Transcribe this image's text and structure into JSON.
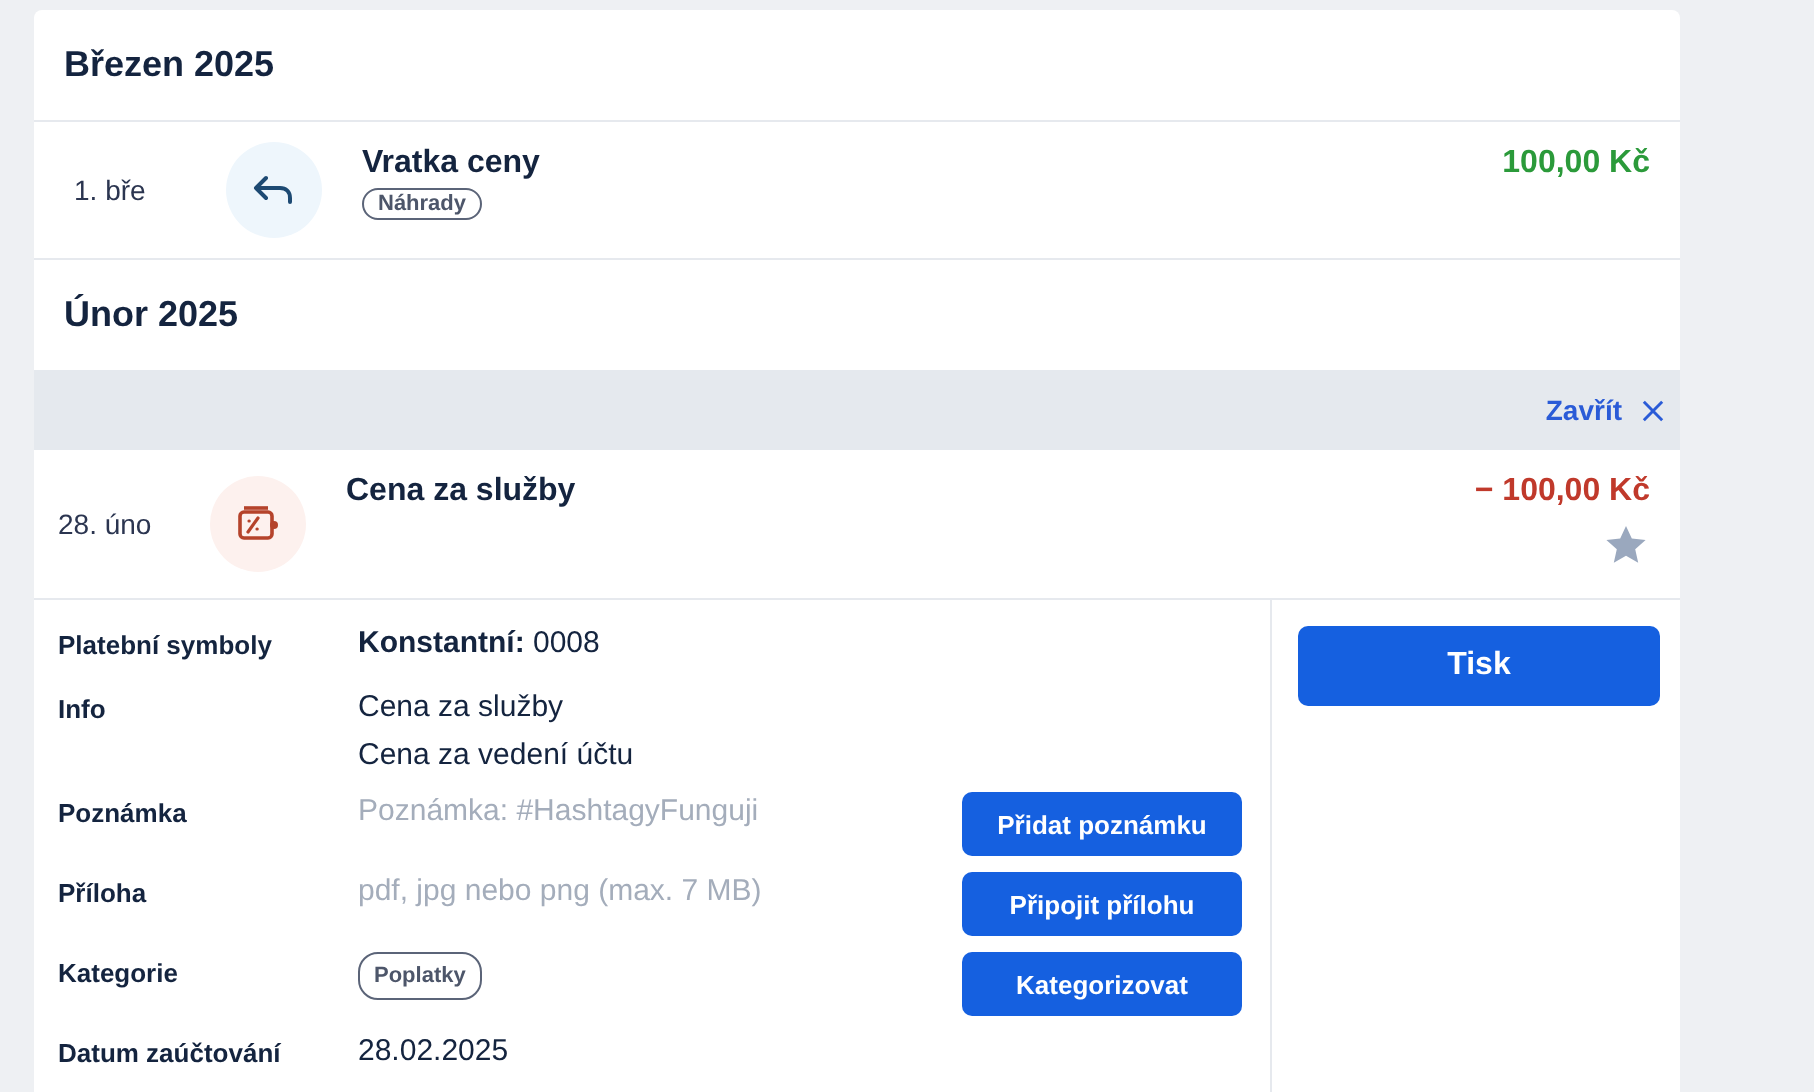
{
  "sections": [
    {
      "month": "Březen 2025",
      "transactions": [
        {
          "date": "1. bře",
          "kind": "return",
          "title": "Vratka ceny",
          "tag": "Náhrady",
          "amount": "100,00 Kč",
          "color": "#2b9a3a",
          "expanded": false
        }
      ]
    },
    {
      "month": "Únor 2025",
      "close_label": "Zavřít",
      "transactions": [
        {
          "date": "28. úno",
          "kind": "fee",
          "title": "Cena za služby",
          "amount": "− 100,00 Kč",
          "color": "#c0392b",
          "expanded": true,
          "favorite": false,
          "details": [
            {
              "kind": "text",
              "label": "Platební symboly",
              "lines": [
                "**Konstantní:** 0008"
              ]
            },
            {
              "kind": "text",
              "label": "Info",
              "lines": [
                "Cena za služby",
                "Cena za vedení účtu"
              ]
            },
            {
              "kind": "hint",
              "label": "Poznámka",
              "placeholder": "Poznámka: #HashtagyFunguji",
              "button": "Přidat poznámku"
            },
            {
              "kind": "hint",
              "label": "Příloha",
              "placeholder": "pdf, jpg nebo png (max. 7 MB)",
              "button": "Připojit přílohu"
            },
            {
              "kind": "tag",
              "label": "Kategorie",
              "tag": "Poplatky",
              "button": "Kategorizovat"
            },
            {
              "kind": "text",
              "label": "Datum zaúčtování",
              "lines": [
                "28.02.2025"
              ]
            }
          ],
          "actions": [
            "Tisk"
          ]
        }
      ]
    }
  ]
}
